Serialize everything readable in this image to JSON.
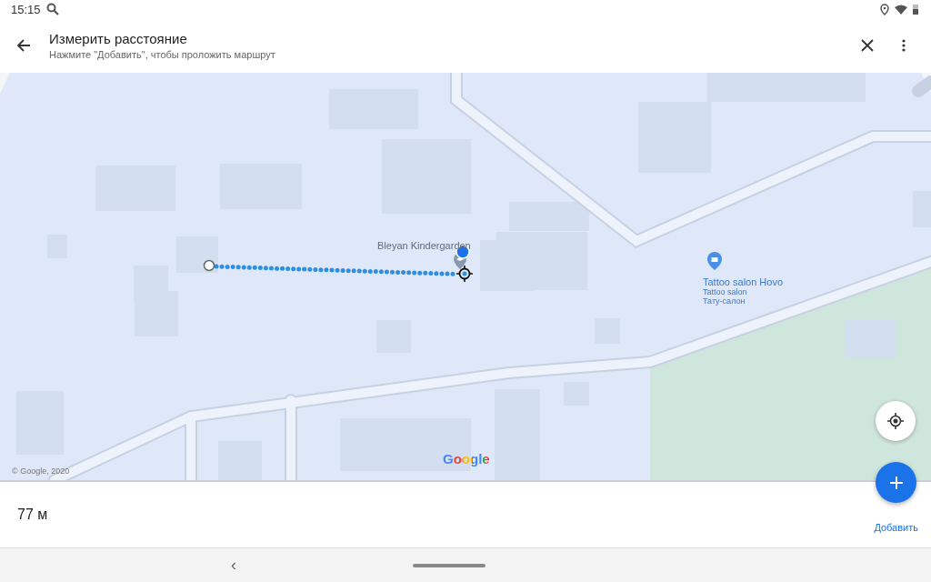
{
  "status_bar": {
    "time": "15:15"
  },
  "header": {
    "title": "Измерить расстояние",
    "subtitle": "Нажмите \"Добавить\", чтобы проложить маршрут"
  },
  "map": {
    "places": [
      {
        "name": "Bleyan Kindergarden",
        "kind": "school"
      },
      {
        "name": "Tattoo salon Hovo",
        "kind": "shop",
        "lines": [
          "Tattoo salon",
          "Тату-салон"
        ]
      }
    ],
    "copyright": "© Google, 2020",
    "logo": "Google"
  },
  "measurement": {
    "distance": "77 м",
    "add_label": "Добавить"
  },
  "nav_bar": {
    "back": "‹"
  }
}
